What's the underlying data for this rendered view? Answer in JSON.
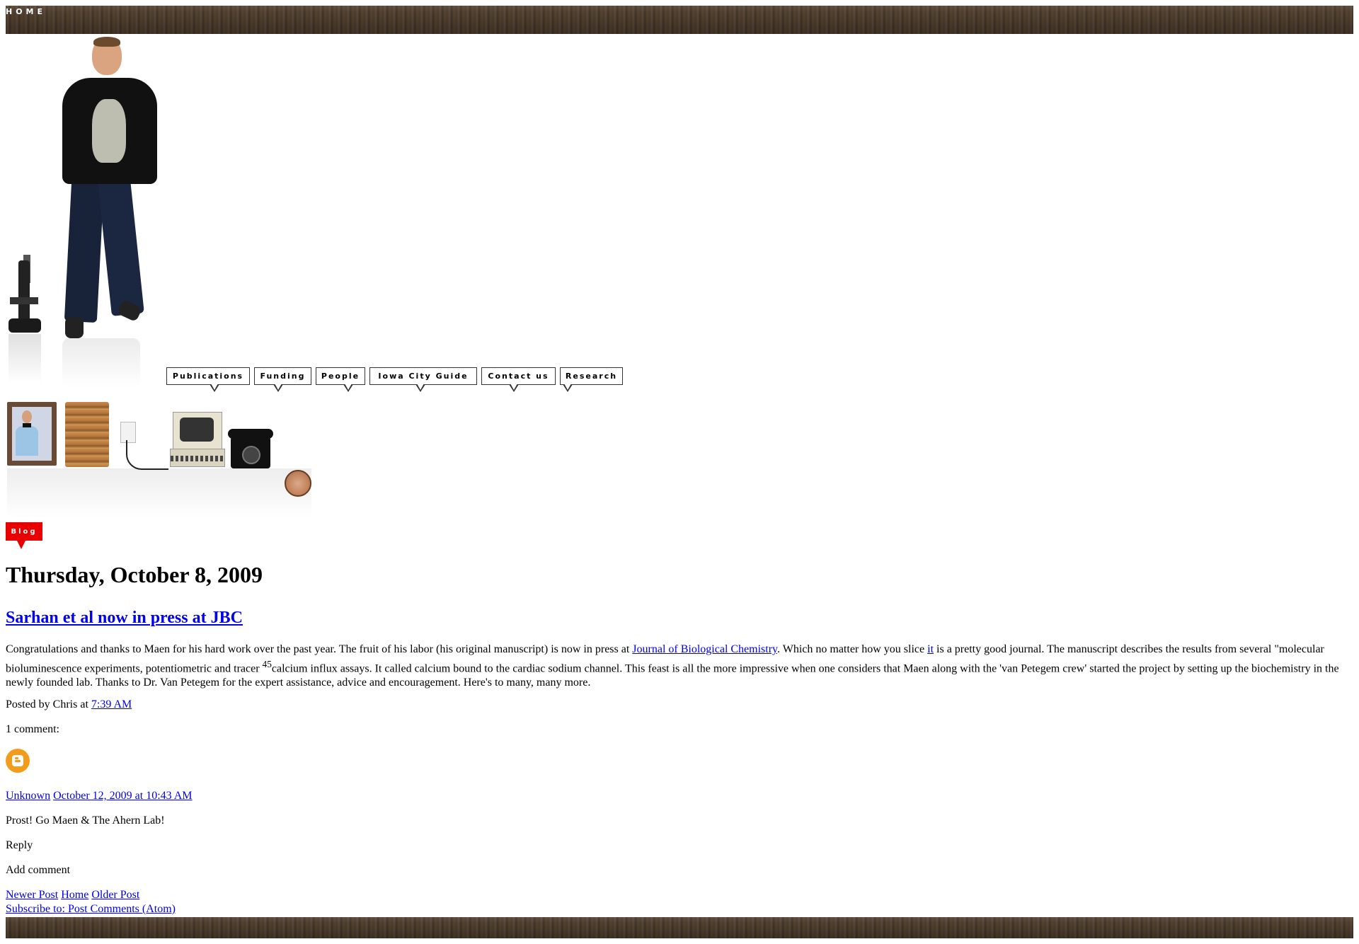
{
  "top_nav": {
    "home_label": "HOME"
  },
  "nav": {
    "publications": "Publications",
    "funding": "Funding",
    "people": "People",
    "iowa_city_guide": "Iowa City Guide",
    "contact_us": "Contact us",
    "research": "Research"
  },
  "blog_badge": "Blog",
  "post": {
    "date_header": "Thursday, October 8, 2009",
    "title": "Sarhan et al now in press at JBC",
    "body_part1": "Congratulations and thanks to Maen for his hard work over the past year. The fruit of his labor (his original manuscript) is now in press at ",
    "journal_link": "Journal of Biological Chemistry",
    "body_part2": ". Which no matter how you slice ",
    "it_link": "it",
    "body_part3": " is a pretty good journal. The manuscript describes the results from several \"molecular bioluminescence experiments, potentiometric and tracer ",
    "superscript": "45",
    "body_part4": "calcium influx assays. It called calcium bound to the cardiac sodium channel. This feast is all the more impressive when one considers that Maen along with the 'van Petegem crew' started the project by setting up the biochemistry in the newly founded lab. Thanks to Dr. Van Petegem for the expert assistance, advice and encouragement. Here's to many, many more.",
    "posted_by": "Posted by Chris at ",
    "time_link": "7:39 AM"
  },
  "comments": {
    "count_label": "1 comment:",
    "author": "Unknown",
    "timestamp": "October 12, 2009 at 10:43 AM",
    "text": "Prost! Go Maen & The Ahern Lab!",
    "reply_label": "Reply",
    "add_comment_label": "Add comment"
  },
  "pager": {
    "newer": "Newer Post",
    "home": "Home",
    "older": "Older Post",
    "subscribe": "Subscribe to: Post Comments (Atom)"
  },
  "colors": {
    "link": "#0000ee",
    "badge": "#e80000",
    "wood": "#4a3b2e",
    "avatar": "#f39c1c"
  }
}
